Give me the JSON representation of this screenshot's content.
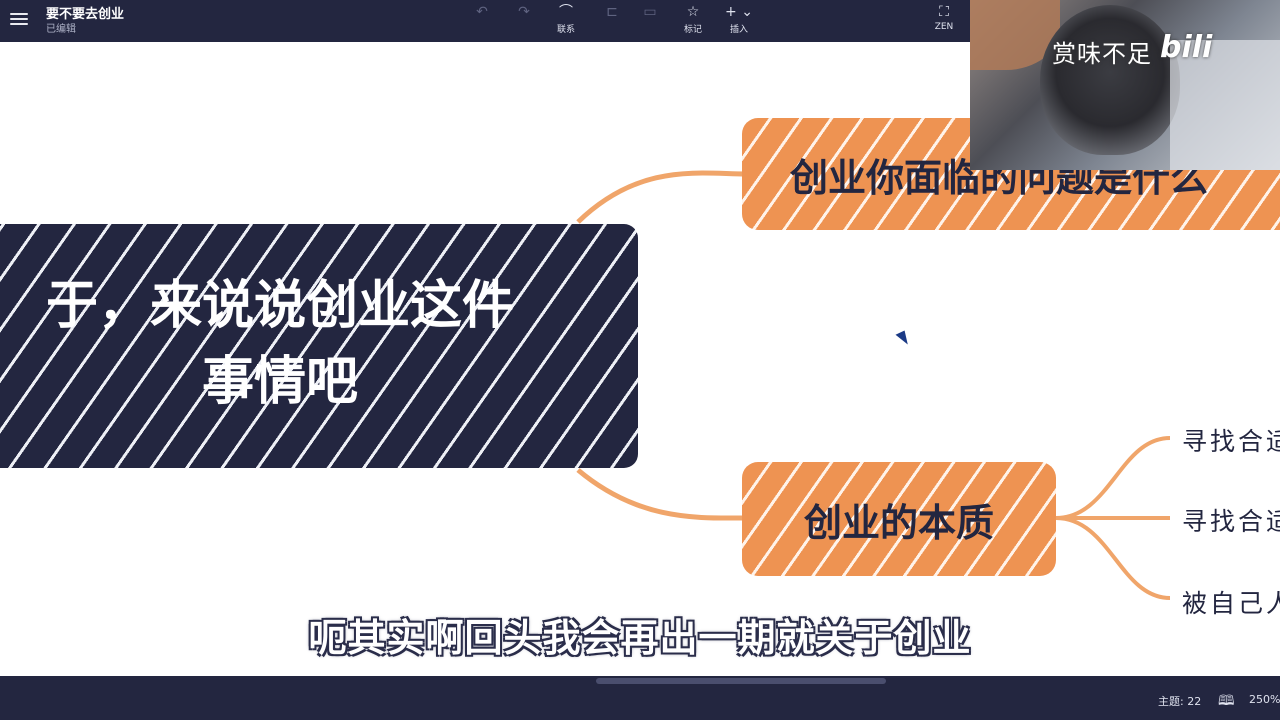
{
  "header": {
    "title": "要不要去创业",
    "status": "已编辑",
    "tools": [
      {
        "label": "",
        "icon": "undo-icon",
        "glyph": "↶",
        "enabled": false
      },
      {
        "label": "",
        "icon": "redo-icon",
        "glyph": "↷",
        "enabled": false
      },
      {
        "label": "联系",
        "icon": "relation-icon",
        "glyph": "⌒",
        "enabled": true
      },
      {
        "label": "",
        "icon": "summary-icon",
        "glyph": "⊏",
        "enabled": false
      },
      {
        "label": "",
        "icon": "boundary-icon",
        "glyph": "▭",
        "enabled": false
      },
      {
        "label": "标记",
        "icon": "star-icon",
        "glyph": "☆",
        "enabled": true
      },
      {
        "label": "插入",
        "icon": "plus-icon",
        "glyph": "+ ⌄",
        "enabled": true
      },
      {
        "label": "ZEN",
        "icon": "fullscreen-icon",
        "glyph": "⛶",
        "enabled": true
      }
    ]
  },
  "webcam": {
    "watermark": "赏味不足",
    "logo": "bilibili"
  },
  "mindmap": {
    "central_topic": "于，来说说创业这件\n事情吧",
    "branches": [
      {
        "label": "创业你面临的问题是什么"
      },
      {
        "label": "创业的本质"
      }
    ],
    "leaves": [
      "寻找合适",
      "寻找合适",
      "被自己人"
    ]
  },
  "subtitle": "呃其实啊回头我会再出一期就关于创业",
  "status_bar": {
    "topics": "主题: 22",
    "zoom": "250%"
  },
  "colors": {
    "dark": "#232640",
    "orange": "#ee9352",
    "connector": "#f0a56a"
  }
}
